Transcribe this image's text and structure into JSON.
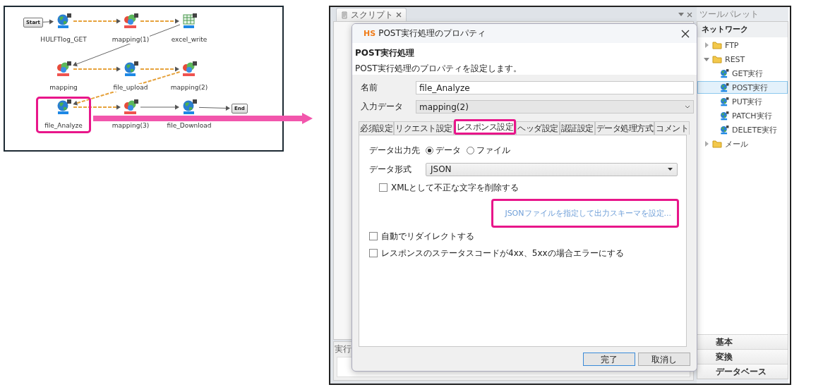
{
  "diagram": {
    "nodes": [
      {
        "kind": "start",
        "label": "Start"
      },
      {
        "kind": "rest",
        "label": "HULFTlog_GET",
        "dashed_link": false,
        "highlighted": false
      },
      {
        "kind": "mapper",
        "label": "mapping(1)",
        "dashed_link": true,
        "highlighted": false
      },
      {
        "kind": "excel",
        "label": "excel_write",
        "dashed_link": true,
        "highlighted": false
      },
      {
        "kind": "mapper",
        "label": "mapping",
        "dashed_link": false,
        "highlighted": false
      },
      {
        "kind": "rest",
        "label": "file_upload",
        "dashed_link": true,
        "highlighted": false
      },
      {
        "kind": "mapper",
        "label": "mapping(2)",
        "dashed_link": true,
        "highlighted": false
      },
      {
        "kind": "rest",
        "label": "file_Analyze",
        "dashed_link": true,
        "highlighted": true
      },
      {
        "kind": "mapper",
        "label": "mapping(3)",
        "dashed_link": true,
        "highlighted": false
      },
      {
        "kind": "rest",
        "label": "file_Download",
        "dashed_link": false,
        "highlighted": false
      },
      {
        "kind": "end",
        "label": "End",
        "dashed_link": false
      }
    ]
  },
  "ide": {
    "editor_tab": "スクリプト",
    "bottom_tab": "実行",
    "palette": {
      "title": "ツールパレット",
      "section": "ネットワーク",
      "tree": [
        {
          "label": "FTP",
          "expanded": false
        },
        {
          "label": "REST",
          "expanded": true,
          "children": [
            {
              "label": "GET実行",
              "selected": false
            },
            {
              "label": "POST実行",
              "selected": true
            },
            {
              "label": "PUT実行",
              "selected": false
            },
            {
              "label": "PATCH実行",
              "selected": false
            },
            {
              "label": "DELETE実行",
              "selected": false
            }
          ]
        },
        {
          "label": "メール",
          "expanded": false
        }
      ],
      "categories": [
        "基本",
        "変換",
        "データベース"
      ]
    }
  },
  "dialog": {
    "logo": "HS",
    "title": "POST実行処理のプロパティ",
    "heading": "POST実行処理",
    "description": "POST実行処理のプロパティを設定します。",
    "fields": [
      {
        "kind": "text",
        "label": "名前",
        "value": "file_Analyze"
      },
      {
        "kind": "select",
        "label": "入力データ",
        "value": "mapping(2)"
      }
    ],
    "tabs": [
      {
        "label": "必須設定",
        "selected": false,
        "highlighted": false
      },
      {
        "label": "リクエスト設定",
        "selected": false,
        "highlighted": false
      },
      {
        "label": "レスポンス設定",
        "selected": true,
        "highlighted": true
      },
      {
        "label": "ヘッダ設定",
        "selected": false,
        "highlighted": false
      },
      {
        "label": "認証設定",
        "selected": false,
        "highlighted": false
      },
      {
        "label": "データ処理方式",
        "selected": false,
        "highlighted": false
      },
      {
        "label": "コメント",
        "selected": false,
        "highlighted": false
      }
    ],
    "response": {
      "output": {
        "label": "データ出力先",
        "options": [
          {
            "label": "データ",
            "selected": true
          },
          {
            "label": "ファイル",
            "selected": false
          }
        ]
      },
      "format": {
        "label": "データ形式",
        "value": "JSON"
      },
      "strip_xml": {
        "label": "XMLとして不正な文字を削除する",
        "checked": false
      },
      "schema_link": {
        "label": "JSONファイルを指定して出力スキーマを設定...",
        "highlighted": true
      },
      "options": [
        {
          "label": "自動でリダイレクトする",
          "checked": false
        },
        {
          "label": "レスポンスのステータスコードが4xx、5xxの場合エラーにする",
          "checked": false
        }
      ]
    },
    "buttons": [
      {
        "label": "完了",
        "default": true
      },
      {
        "label": "取消し",
        "default": false
      }
    ]
  }
}
